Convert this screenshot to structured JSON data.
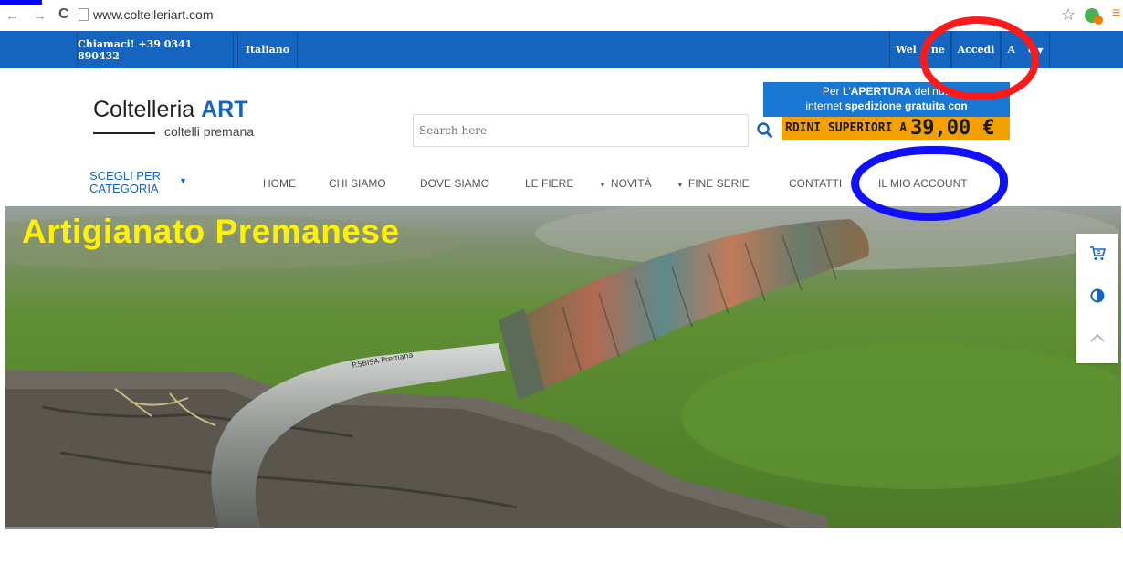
{
  "browser": {
    "url": "www.coltelleriart.com",
    "icons": [
      "back-icon",
      "forward-icon",
      "reload-icon",
      "page-icon",
      "star-icon",
      "extension-icon",
      "menu-icon"
    ]
  },
  "topbar": {
    "phone": "Chiamaci! +39 0341 890432",
    "language": "Italiano",
    "welcome": "Wel",
    "welcome_tail": "ne",
    "login": "Accedi",
    "account_short": "A",
    "account_tail": "o"
  },
  "logo": {
    "main": "Coltelleria",
    "brand": "ART",
    "sub": "coltelli premana"
  },
  "search": {
    "placeholder": "Search here"
  },
  "promo": {
    "line1_pre": "Per L'",
    "line1_bold": "APERTURA",
    "line1_post": " del nuo",
    "line2_pre": "internet ",
    "line2_bold": "spedizione gratuita con",
    "bottom_text": "RDINI SUPERIORI A",
    "bottom_amount": "39,00 €"
  },
  "nav": {
    "category_line1": "SCEGLI PER",
    "category_line2": "CATEGORIA",
    "items": [
      "HOME",
      "CHI SIAMO",
      "DOVE SIAMO",
      "LE FIERE",
      "NOVITÀ",
      "FINE SERIE",
      "CONTATTI",
      "IL MIO ACCOUNT"
    ]
  },
  "hero": {
    "title": "Artigianato Premanese",
    "blade_text": "P.SBISA Premana"
  },
  "side_tools": [
    "cart-icon",
    "contrast-icon",
    "scroll-top-icon"
  ],
  "colors": {
    "primary": "#1565c0",
    "promo_orange": "#f4a000",
    "hero_title": "#fff200",
    "annotation_red": "#ff1a1a",
    "annotation_blue": "#1010ff"
  }
}
